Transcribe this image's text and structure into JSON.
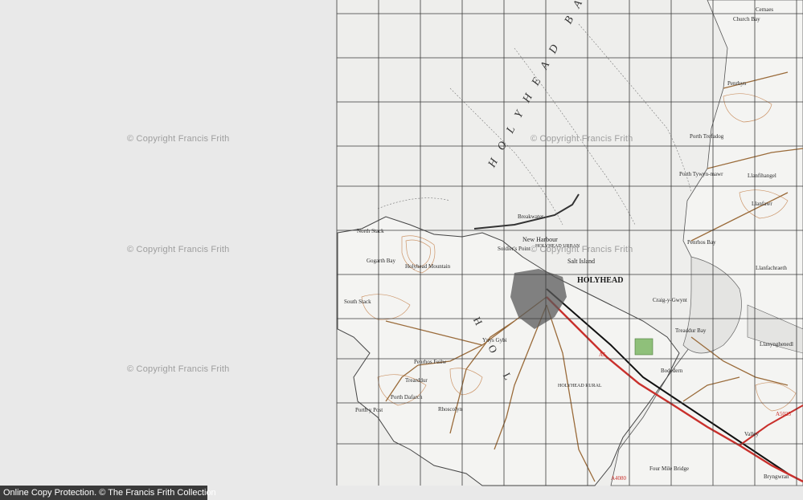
{
  "watermark": "© Copyright Francis Frith",
  "footer": {
    "text": "Online Copy Protection.  © The Francis Frith Collection"
  },
  "map": {
    "sea_label": "HOLYHEAD BA",
    "land_label": "HOL",
    "towns": {
      "holyhead": "HOLYHEAD",
      "holyhead_urban": "HOLYHEAD URBAN",
      "holyhead_rural": "HOLYHEAD RURAL",
      "new_harbour": "New Harbour",
      "salt_island": "Salt Island"
    },
    "places": [
      "Breakwater",
      "North Stack",
      "Gogarth Bay",
      "Holyhead Mountain",
      "Soldier's Point",
      "South Stack",
      "Penrhos Feilw",
      "Trearddur",
      "Porth Dafarch",
      "Rhoscolyn",
      "Porth y Post",
      "Valley",
      "Llanfawr",
      "Penrhos Bay",
      "Ynys Gybi",
      "Porth Tywyn-mawr",
      "Bodedern",
      "Four Mile Bridge",
      "Llanfihangel",
      "Craig-y-Gwynt",
      "Cemaes",
      "Church Bay",
      "Porth Trefadog",
      "Treaddur Bay",
      "Penrhyn",
      "Llanfachraeth",
      "Llanynghenedl",
      "Bryngwran"
    ],
    "road_labels": [
      "A5",
      "A5025",
      "A4080"
    ],
    "colors": {
      "land": "#f4f4f2",
      "sea": "#e9e9e9",
      "grid": "#3a3a3a",
      "road_red": "#c9302c",
      "road_brown": "#9a6b3a",
      "contour": "#c88b5a",
      "woodland": "#8fc07a"
    }
  }
}
